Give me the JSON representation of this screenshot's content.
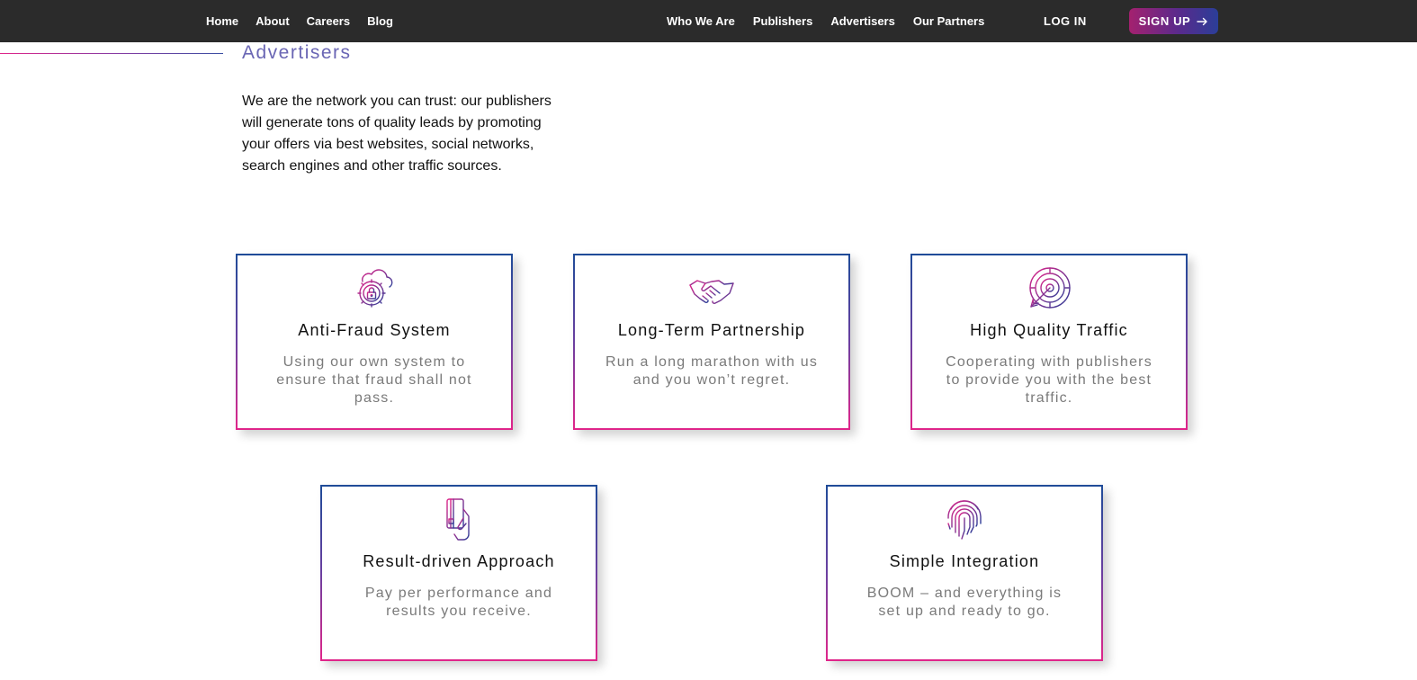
{
  "nav": {
    "left": [
      "Home",
      "About",
      "Careers",
      "Blog"
    ],
    "right": [
      "Who We Are",
      "Publishers",
      "Advertisers",
      "Our Partners"
    ],
    "login_label": "LOG IN",
    "signup_label": "SIGN UP"
  },
  "section": {
    "title": "Advertisers",
    "intro": "We are the network you can trust: our publishers will generate tons of quality leads by promoting your offers via best websites, social networks, search engines and other traffic sources."
  },
  "cards": [
    {
      "icon": "cloud-lock-gear-icon",
      "title": "Anti-Fraud System",
      "desc": "Using our own system to ensure that fraud shall not pass."
    },
    {
      "icon": "handshake-icon",
      "title": "Long-Term Partnership",
      "desc": "Run a long marathon with us and you won’t regret."
    },
    {
      "icon": "target-icon",
      "title": "High Quality Traffic",
      "desc": "Cooperating with publishers to provide you with the best traffic."
    },
    {
      "icon": "card-hand-icon",
      "title": "Result-driven Approach",
      "desc": "Pay per performance and results you receive."
    },
    {
      "icon": "fingerprint-icon",
      "title": "Simple Integration",
      "desc": "BOOM – and everything is set up and ready to go."
    }
  ],
  "colors": {
    "nav_bg": "#2b2b2b",
    "accent_pink": "#e0258a",
    "accent_blue": "#1f4b98",
    "title_purple": "#6a66b4"
  }
}
